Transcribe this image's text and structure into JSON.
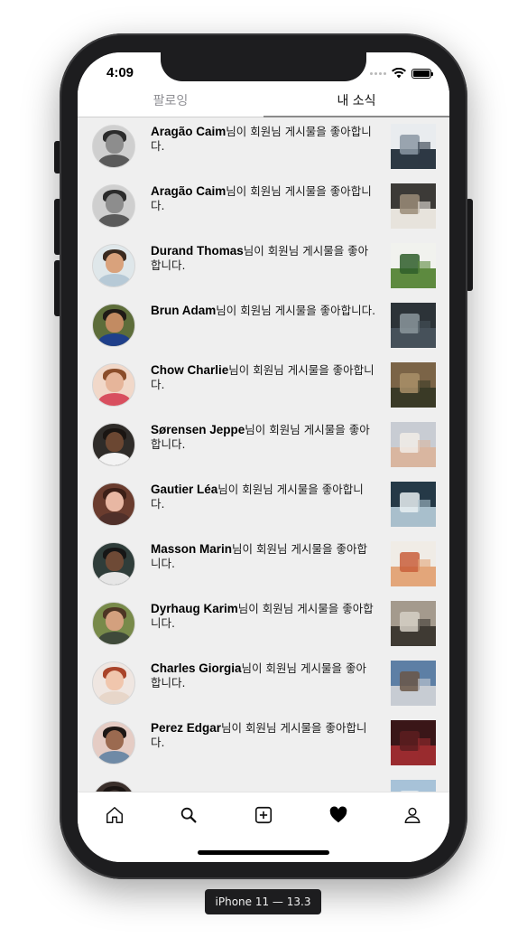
{
  "status_bar": {
    "time": "4:09"
  },
  "top_tabs": [
    {
      "label": "팔로잉",
      "active": false
    },
    {
      "label": "내 소식",
      "active": true
    }
  ],
  "notifications": [
    {
      "name": "Aragão Caim",
      "text": "님이 회원님 게시물을 좋아합니다.",
      "avatar": "bw-curly",
      "thumb": "building"
    },
    {
      "name": "Aragão Caim",
      "text": "님이 회원님 게시물을 좋아합니다.",
      "avatar": "bw-curly",
      "thumb": "person-storefront"
    },
    {
      "name": "Durand Thomas",
      "text": "님이 회원님 게시물을 좋아합니다.",
      "avatar": "smiling-man",
      "thumb": "plant"
    },
    {
      "name": "Brun Adam",
      "text": "님이 회원님 게시물을 좋아합니다.",
      "avatar": "young-man",
      "thumb": "dark-mountain"
    },
    {
      "name": "Chow Charlie",
      "text": "님이 회원님 게시물을 좋아합니다.",
      "avatar": "smiling-woman",
      "thumb": "forest"
    },
    {
      "name": "Sørensen Jeppe",
      "text": "님이 회원님 게시물을 좋아합니다.",
      "avatar": "man-dark",
      "thumb": "beach"
    },
    {
      "name": "Gautier Léa",
      "text": "님이 회원님 게시물을 좋아합니다.",
      "avatar": "laughing-woman",
      "thumb": "modern-house"
    },
    {
      "name": "Masson Marin",
      "text": "님이 회원님 게시물을 좋아합니다.",
      "avatar": "woman-curly",
      "thumb": "still-life"
    },
    {
      "name": "Dyrhaug Karim",
      "text": "님이 회원님 게시물을 좋아합니다.",
      "avatar": "bearded-man",
      "thumb": "seals"
    },
    {
      "name": "Charles Giorgia",
      "text": "님이 회원님 게시물을 좋아합니다.",
      "avatar": "redhead-woman",
      "thumb": "mountains"
    },
    {
      "name": "Perez Edgar",
      "text": "님이 회원님 게시물을 좋아합니다.",
      "avatar": "man-glasses",
      "thumb": "red-leaves"
    },
    {
      "name": "",
      "text": "",
      "avatar": "partial",
      "thumb": "sky"
    }
  ],
  "tab_bar": [
    {
      "icon": "home-icon",
      "active": false
    },
    {
      "icon": "search-icon",
      "active": false
    },
    {
      "icon": "add-post-icon",
      "active": false
    },
    {
      "icon": "heart-icon",
      "active": true
    },
    {
      "icon": "profile-icon",
      "active": false
    }
  ],
  "device_label": "iPhone 11 — 13.3",
  "colors": {
    "screen_bg": "#efefef",
    "frame": "#1d1d1f",
    "tab_text_inactive": "#8e8e93"
  }
}
